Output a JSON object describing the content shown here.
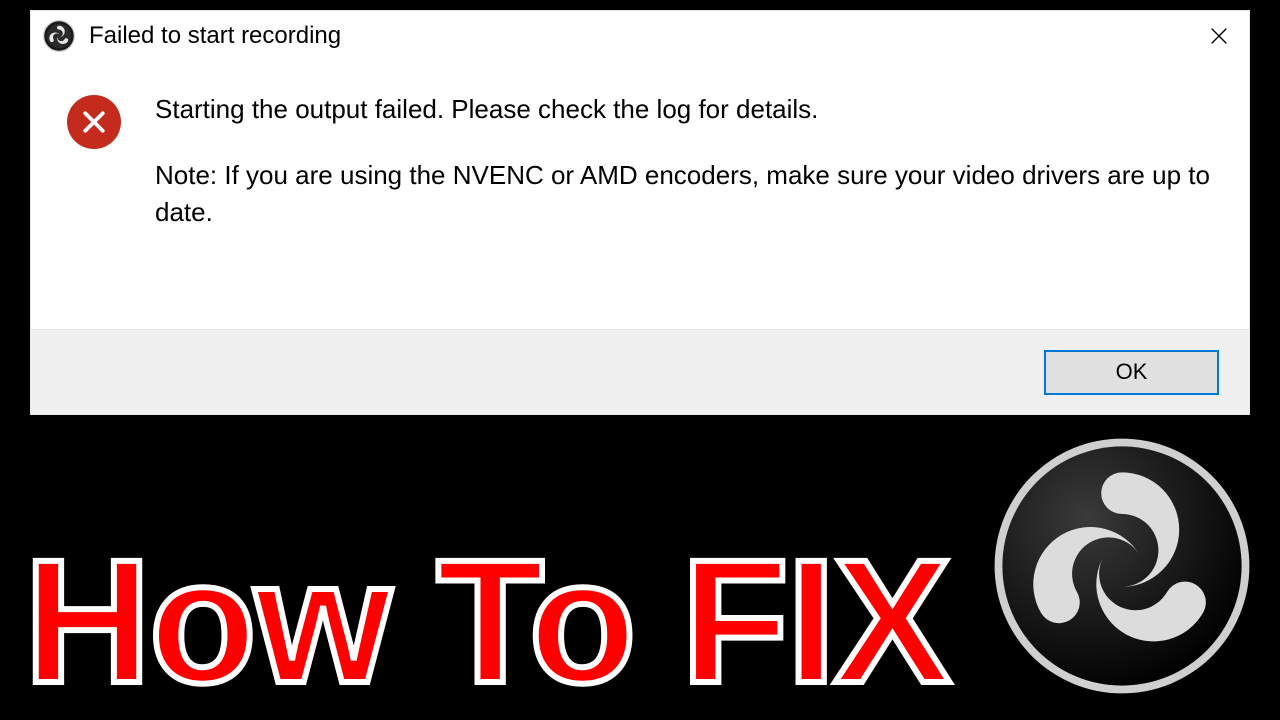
{
  "dialog": {
    "title": "Failed to start recording",
    "message_primary": "Starting the output failed.  Please check the log for details.",
    "message_note": "Note: If you are using the NVENC or AMD encoders, make sure your video drivers are up to date.",
    "ok_label": "OK"
  },
  "caption": "How To FIX",
  "colors": {
    "error_red": "#c42b1c",
    "caption_red": "#ff0000",
    "focus_blue": "#0078d7"
  }
}
